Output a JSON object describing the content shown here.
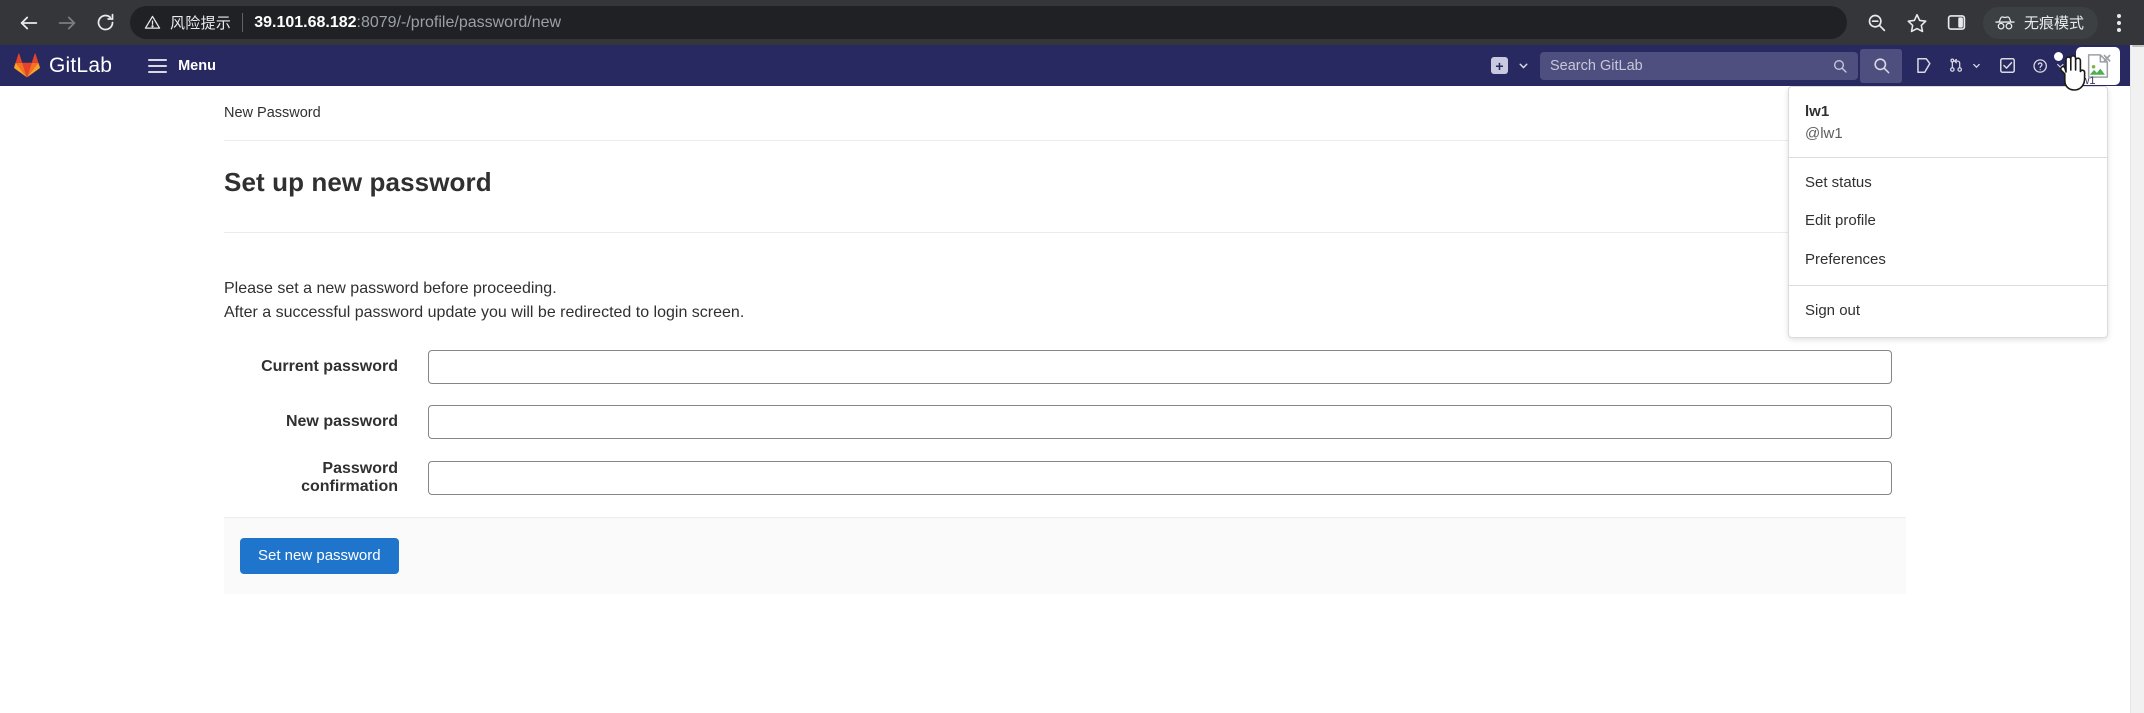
{
  "browser": {
    "back_label": "Back",
    "forward_label": "Forward",
    "reload_label": "Reload",
    "warning_icon": "warning-triangle-icon",
    "warning_text": "风险提示",
    "url_host": "39.101.68.182",
    "url_rest": ":8079/-/profile/password/new",
    "zoom_out_icon": "zoom-out-icon",
    "bookmark_icon": "star-icon",
    "side_panel_icon": "side-panel-icon",
    "incognito_icon": "incognito-icon",
    "incognito_label": "无痕模式",
    "menu_icon": "kebab-menu-icon"
  },
  "navbar": {
    "logo_icon": "gitlab-logo-icon",
    "brand": "GitLab",
    "menu_icon": "hamburger-icon",
    "menu_label": "Menu",
    "new_icon": "plus-square-icon",
    "new_chevron_icon": "chevron-down-icon",
    "search_icon": "search-icon",
    "search_placeholder": "Search GitLab",
    "search_value": "",
    "search_toggle_icon": "search-icon",
    "issues_icon": "issues-icon",
    "merge_requests_icon": "merge-request-icon",
    "merge_requests_chevron_icon": "chevron-down-icon",
    "todos_icon": "todo-checkbox-icon",
    "help_icon": "question-circle-icon",
    "help_chevron_icon": "chevron-down-icon",
    "avatar_icon": "broken-image-icon",
    "avatar_name": "lw1",
    "cursor_icon": "hand-cursor-icon",
    "accent_color": "#292961"
  },
  "user_dropdown": {
    "name": "lw1",
    "handle": "@lw1",
    "items_primary": [
      {
        "label": "Set status"
      },
      {
        "label": "Edit profile"
      },
      {
        "label": "Preferences"
      }
    ],
    "items_secondary": [
      {
        "label": "Sign out"
      }
    ]
  },
  "page": {
    "breadcrumb": "New Password",
    "title": "Set up new password",
    "intro_line1": "Please set a new password before proceeding.",
    "intro_line2": "After a successful password update you will be redirected to login screen.",
    "fields": [
      {
        "label": "Current password",
        "value": "",
        "placeholder": ""
      },
      {
        "label": "New password",
        "value": "",
        "placeholder": ""
      },
      {
        "label": "Password confirmation",
        "value": "",
        "placeholder": ""
      }
    ],
    "submit_label": "Set new password",
    "submit_color": "#1f75cb"
  }
}
